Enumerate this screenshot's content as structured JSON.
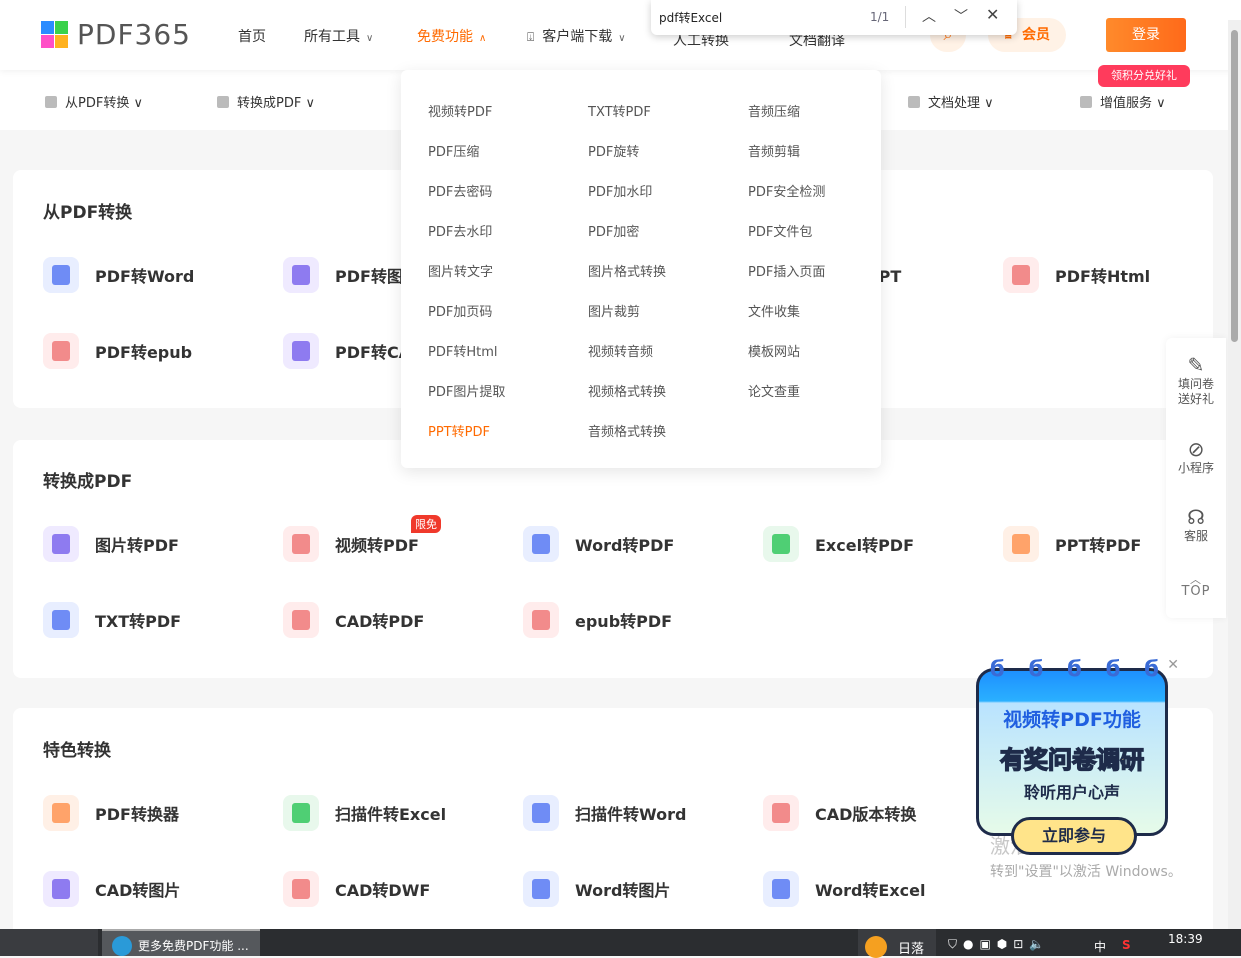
{
  "header": {
    "logo": "PDF365",
    "nav": [
      {
        "label": "首页"
      },
      {
        "label": "所有工具",
        "chevron": true
      },
      {
        "label": "免费功能",
        "chevron": true,
        "active": true
      },
      {
        "label": "客户端下载",
        "chevron": true
      },
      {
        "label": "人工转换"
      },
      {
        "label": "文档翻译"
      }
    ],
    "vip": "会员",
    "login": "登录",
    "login_badge": "领积分兑好礼",
    "accent": "#ff6a00"
  },
  "find_bar": {
    "query": "pdf转Excel",
    "count": "1/1"
  },
  "subnav": [
    {
      "label": "从PDF转换"
    },
    {
      "label": "转换成PDF"
    },
    {
      "label": "文档处理"
    },
    {
      "label": "增值服务"
    }
  ],
  "dropdown": {
    "columns": [
      [
        "视频转PDF",
        "PDF压缩",
        "PDF去密码",
        "PDF去水印",
        "图片转文字",
        "PDF加页码",
        "PDF转Html",
        "PDF图片提取",
        "PPT转PDF"
      ],
      [
        "TXT转PDF",
        "PDF旋转",
        "PDF加水印",
        "PDF加密",
        "图片格式转换",
        "图片裁剪",
        "视频转音频",
        "视频格式转换",
        "音频格式转换"
      ],
      [
        "音频压缩",
        "音频剪辑",
        "PDF安全检测",
        "PDF文件包",
        "PDF插入页面",
        "文件收集",
        "模板网站",
        "论文查重"
      ]
    ],
    "active": "PPT转PDF"
  },
  "sections": [
    {
      "title": "从PDF转换",
      "tools": [
        [
          "PDF转Word",
          "PDF转图片",
          "",
          "PDF转PPT",
          "PDF转Html"
        ],
        [
          "PDF转epub",
          "PDF转CAD"
        ]
      ]
    },
    {
      "title": "转换成PDF",
      "tools": [
        [
          "图片转PDF",
          "视频转PDF",
          "Word转PDF",
          "Excel转PDF",
          "PPT转PDF"
        ],
        [
          "TXT转PDF",
          "CAD转PDF",
          "epub转PDF"
        ]
      ],
      "badge": "限免"
    },
    {
      "title": "特色转换",
      "tools": [
        [
          "PDF转换器",
          "扫描件转Excel",
          "扫描件转Word",
          "CAD版本转换"
        ],
        [
          "CAD转图片",
          "CAD转DWF",
          "Word转图片",
          "Word转Excel"
        ]
      ]
    }
  ],
  "side_tools": [
    {
      "label": "填问卷\n送好礼",
      "icon": "form-icon"
    },
    {
      "label": "小程序",
      "icon": "mini-program-icon"
    },
    {
      "label": "客服",
      "icon": "headset-icon"
    },
    {
      "label": "TOP",
      "icon": "chevron-up-icon"
    }
  ],
  "promo": {
    "line1": "视频转PDF功能",
    "line2": "有奖问卷调研",
    "line3": "聆听用户心声",
    "cta": "立即参与"
  },
  "watermark": {
    "line1": "激活 Windows",
    "line2": "转到\"设置\"以激活 Windows。"
  },
  "taskbar": {
    "window": "更多免费PDF功能 ...",
    "weather": "日落",
    "ime": "中",
    "time": "18:39"
  }
}
